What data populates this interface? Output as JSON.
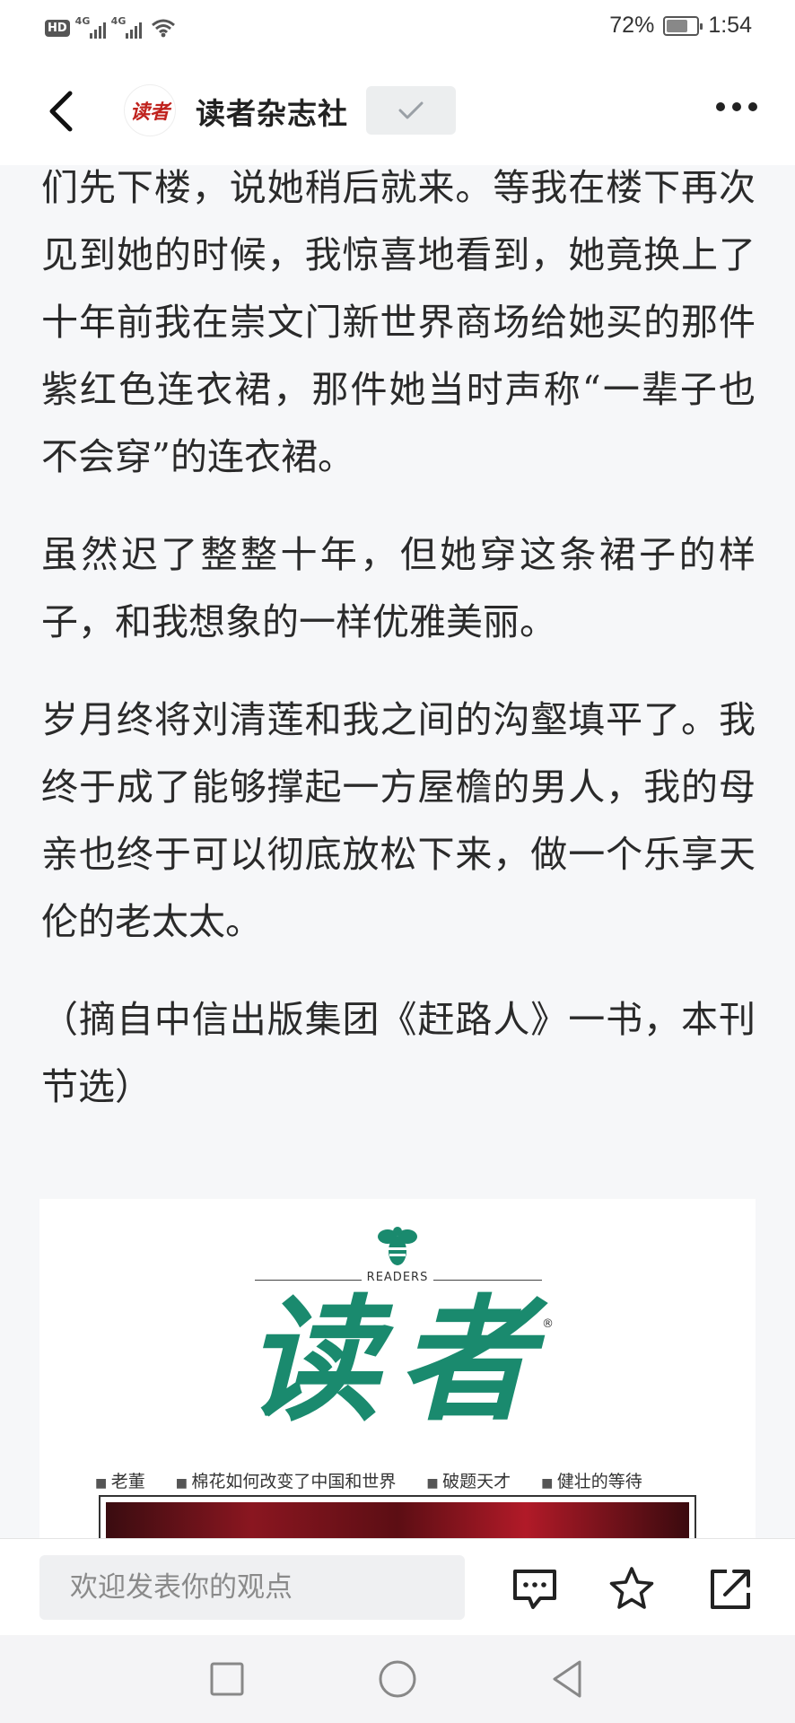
{
  "status_bar": {
    "hd_label": "HD",
    "network_1": "4G",
    "network_2": "4G",
    "battery_percent_text": "72%",
    "battery_level": 0.72,
    "time": "1:54"
  },
  "header": {
    "logo_text": "读者",
    "account_name": "读者杂志社",
    "follow_state_icon": "checkmark-icon",
    "more_icon": "more-dots-icon",
    "back_icon": "chevron-left-icon"
  },
  "article": {
    "paragraphs": [
      "们先下楼，说她稍后就来。等我在楼下再次见到她的时候，我惊喜地看到，她竟换上了十年前我在崇文门新世界商场给她买的那件紫红色连衣裙，那件她当时声称“一辈子也不会穿”的连衣裙。",
      "虽然迟了整整十年，但她穿这条裙子的样子，和我想象的一样优雅美丽。",
      "岁月终将刘清莲和我之间的沟壑填平了。我终于成了能够撑起一方屋檐的男人，我的母亲也终于可以彻底放松下来，做一个乐享天伦的老太太。",
      "（摘自中信出版集团《赶路人》一书，本刊节选）"
    ]
  },
  "cover_image": {
    "brand_en": "READERS",
    "masthead": "读者",
    "registered_mark": "®",
    "toc": [
      "老董",
      "棉花如何改变了中国和世界",
      "破题天才",
      "健壮的等待"
    ],
    "brand_color": "#1a8a6e"
  },
  "bottom_bar": {
    "comment_placeholder": "欢迎发表你的观点",
    "icons": [
      "comment-icon",
      "star-icon",
      "share-icon"
    ]
  },
  "nav_bar": {
    "icons": [
      "recent-apps-icon",
      "home-icon",
      "back-icon"
    ]
  }
}
